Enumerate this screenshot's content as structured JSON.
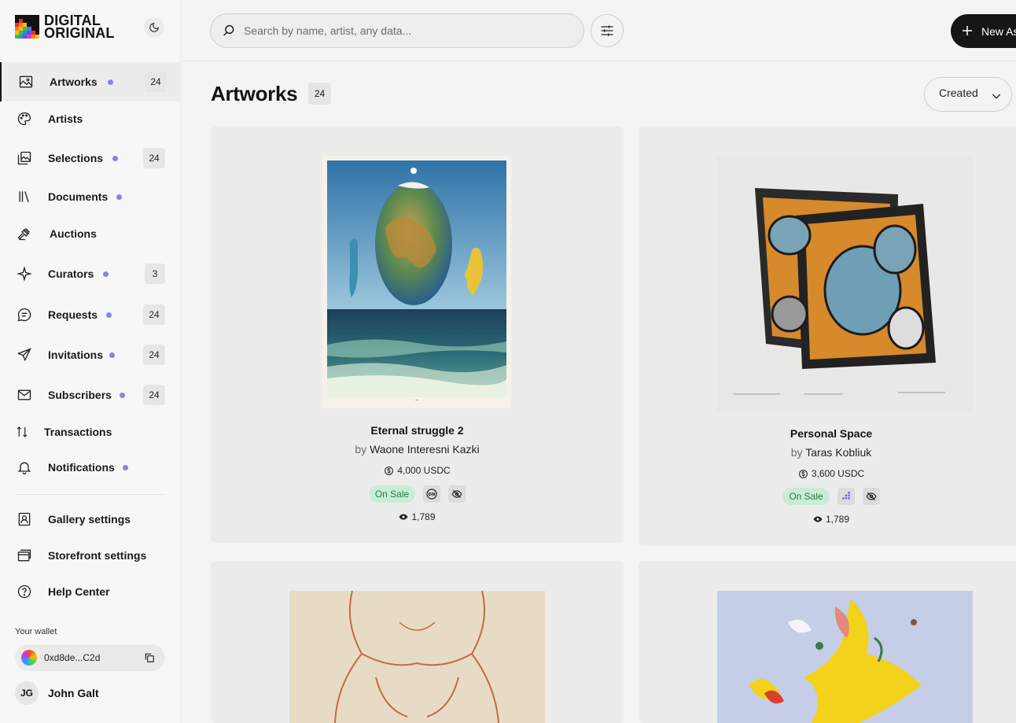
{
  "brand": {
    "line1": "DIGITAL",
    "line2": "ORIGINAL"
  },
  "sidebar": {
    "items": [
      {
        "label": "Artworks",
        "badge": "24",
        "dot": true,
        "active": true,
        "icon": "image-icon"
      },
      {
        "label": "Artists",
        "badge": "",
        "dot": false,
        "icon": "palette-icon"
      },
      {
        "label": "Selections",
        "badge": "24",
        "dot": true,
        "icon": "gallery-stack-icon"
      },
      {
        "label": "Documents",
        "badge": "",
        "dot": true,
        "icon": "library-icon"
      },
      {
        "label": "Auctions",
        "badge": "",
        "dot": false,
        "icon": "gavel-icon"
      },
      {
        "label": "Curators",
        "badge": "3",
        "dot": true,
        "icon": "sparkle-icon"
      },
      {
        "label": "Requests",
        "badge": "24",
        "dot": true,
        "icon": "chat-bubble-icon"
      },
      {
        "label": "Invitations",
        "badge": "24",
        "dot": true,
        "icon": "send-icon"
      },
      {
        "label": "Subscribers",
        "badge": "24",
        "dot": true,
        "icon": "mail-icon"
      },
      {
        "label": "Transactions",
        "badge": "",
        "dot": false,
        "icon": "arrows-updown-icon"
      },
      {
        "label": "Notifications",
        "badge": "",
        "dot": true,
        "icon": "bell-icon"
      }
    ],
    "settings": [
      {
        "label": "Gallery settings",
        "icon": "user-frame-icon"
      },
      {
        "label": "Storefront settings",
        "icon": "window-stack-icon"
      },
      {
        "label": "Help Center",
        "icon": "help-circle-icon"
      }
    ],
    "wallet_label": "Your wallet",
    "wallet_address": "0xd8de...C2d",
    "user_initials": "JG",
    "user_name": "John Galt"
  },
  "topbar": {
    "search_placeholder": "Search by name, artist, any data...",
    "new_button": "New As"
  },
  "main": {
    "title": "Artworks",
    "count": "24",
    "sort_label": "Created",
    "cards": [
      {
        "title": "Eternal struggle 2",
        "by": "by",
        "artist": "Waone Interesni Kazki",
        "price": "4,000 USDC",
        "status": "On Sale",
        "views": "1,789",
        "platform_icon": "dn-badge-icon"
      },
      {
        "title": "Personal Space",
        "by": "by",
        "artist": "Taras Kobliuk",
        "price": "3,600 USDC",
        "status": "On Sale",
        "views": "1,789",
        "platform_icon": "bars-chart-icon"
      }
    ]
  },
  "colors": {
    "accent_dot": "#8585e8",
    "on_sale_bg": "#c9edd4",
    "on_sale_text": "#2c7a43",
    "primary_button": "#161616"
  }
}
